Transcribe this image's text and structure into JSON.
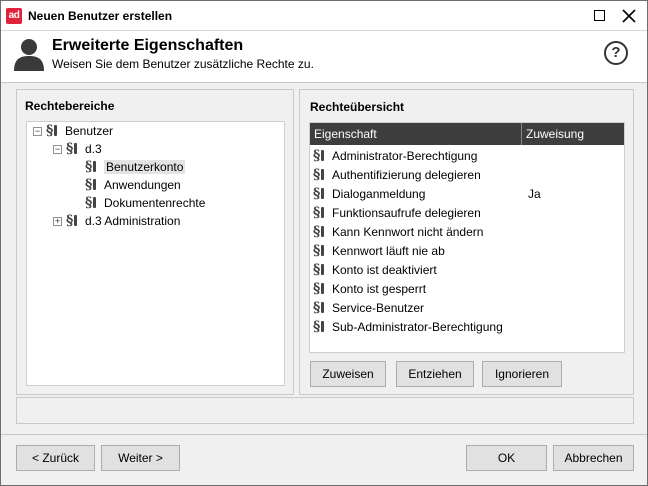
{
  "window": {
    "title": "Neuen Benutzer erstellen",
    "app_icon_text": "ad"
  },
  "header": {
    "title": "Erweiterte Eigenschaften",
    "subtitle": "Weisen Sie dem Benutzer zusätzliche Rechte zu.",
    "help_symbol": "?"
  },
  "left_panel": {
    "title": "Rechtebereiche",
    "tree": [
      {
        "label": "Benutzer",
        "level": 0,
        "expander": "−"
      },
      {
        "label": "d.3",
        "level": 1,
        "expander": "−"
      },
      {
        "label": "Benutzerkonto",
        "level": 2,
        "expander": "",
        "selected": true
      },
      {
        "label": "Anwendungen",
        "level": 2,
        "expander": ""
      },
      {
        "label": "Dokumentenrechte",
        "level": 2,
        "expander": ""
      },
      {
        "label": "d.3 Administration",
        "level": 1,
        "expander": "+"
      }
    ]
  },
  "right_panel": {
    "title": "Rechteübersicht",
    "columns": [
      "Eigenschaft",
      "Zuweisung"
    ],
    "rows": [
      {
        "name": "Administrator-Berechtigung",
        "value": ""
      },
      {
        "name": "Authentifizierung delegieren",
        "value": ""
      },
      {
        "name": "Dialoganmeldung",
        "value": "Ja"
      },
      {
        "name": "Funktionsaufrufe delegieren",
        "value": ""
      },
      {
        "name": "Kann Kennwort nicht ändern",
        "value": ""
      },
      {
        "name": "Kennwort läuft nie ab",
        "value": ""
      },
      {
        "name": "Konto ist deaktiviert",
        "value": ""
      },
      {
        "name": "Konto ist gesperrt",
        "value": ""
      },
      {
        "name": "Service-Benutzer",
        "value": ""
      },
      {
        "name": "Sub-Administrator-Berechtigung",
        "value": ""
      }
    ],
    "buttons": {
      "assign": "Zuweisen",
      "revoke": "Entziehen",
      "ignore": "Ignorieren"
    }
  },
  "footer": {
    "back": "< Zurück",
    "next": "Weiter >",
    "ok": "OK",
    "cancel": "Abbrechen"
  },
  "icons": {
    "paragraph_symbol": "§",
    "accent_color": "#e0223a"
  }
}
